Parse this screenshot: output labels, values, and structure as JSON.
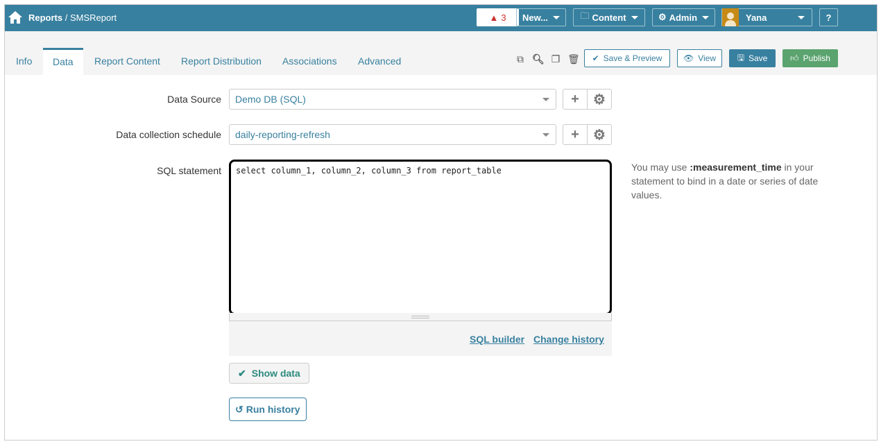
{
  "header": {
    "breadcrumb_root": "Reports",
    "breadcrumb_sep": " / ",
    "breadcrumb_current": "SMSReport",
    "alert_count": "3",
    "new_label": "New...",
    "content_label": "Content",
    "admin_label": "Admin",
    "user_name": "Yana",
    "help_label": "?"
  },
  "tabs": [
    {
      "label": "Info"
    },
    {
      "label": "Data"
    },
    {
      "label": "Report Content"
    },
    {
      "label": "Report Distribution"
    },
    {
      "label": "Associations"
    },
    {
      "label": "Advanced"
    }
  ],
  "actions": {
    "save_preview": "Save & Preview",
    "view": "View",
    "save": "Save",
    "publish": "Publish"
  },
  "form": {
    "data_source_label": "Data Source",
    "data_source_value": "Demo DB (SQL)",
    "schedule_label": "Data collection schedule",
    "schedule_value": "daily-reporting-refresh",
    "sql_label": "SQL statement",
    "sql_value": "select column_1, column_2, column_3 from report_table",
    "help_pre": "You may use ",
    "help_bold": ":measurement_time",
    "help_post": " in your statement to bind in a date or series of date values.",
    "sql_builder": "SQL builder",
    "change_history": "Change history",
    "show_data": "Show data",
    "run_history": "Run history"
  },
  "colors": {
    "brand": "#38809f",
    "publish": "#5ba36f",
    "alert": "#c9302c"
  }
}
